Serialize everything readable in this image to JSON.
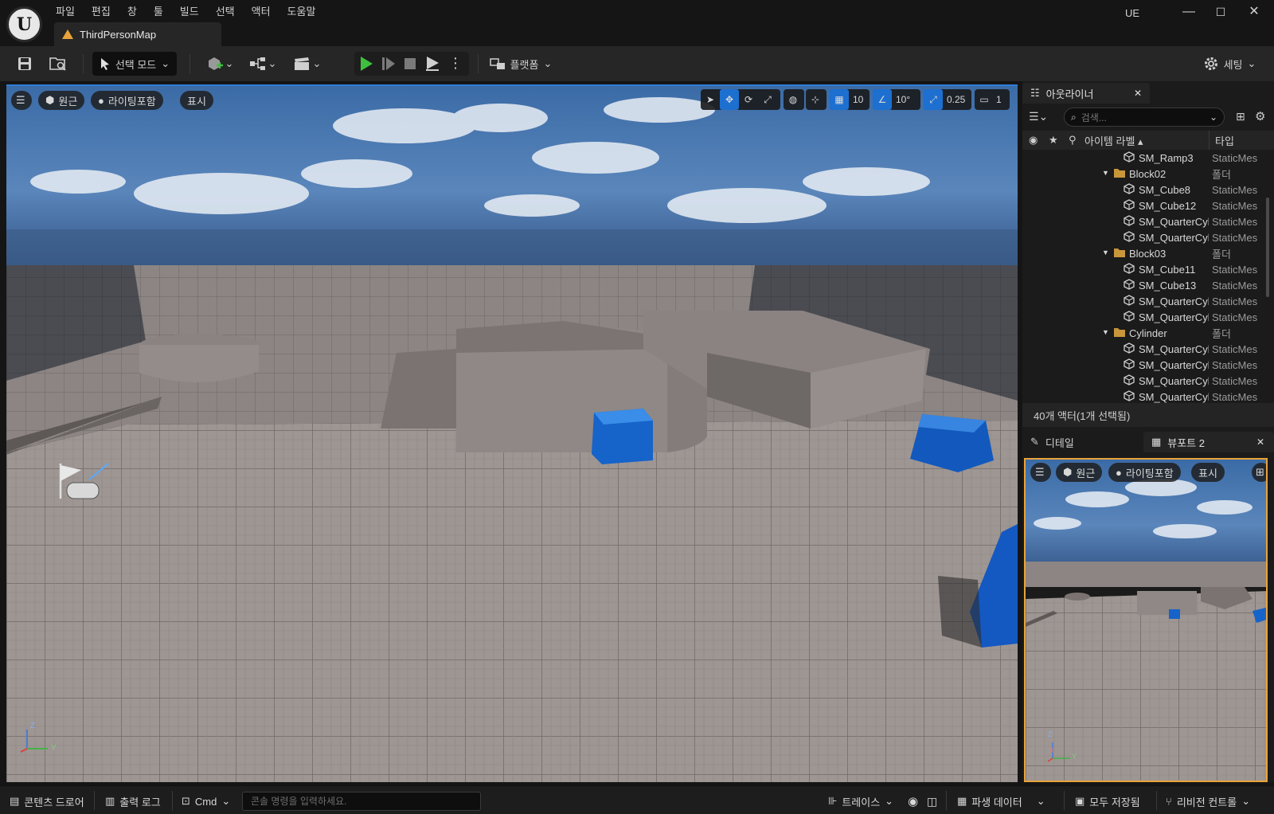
{
  "app": {
    "logo_text": "U",
    "ue_label": "UE",
    "map_tab": "ThirdPersonMap"
  },
  "menu": [
    "파일",
    "편집",
    "창",
    "툴",
    "빌드",
    "선택",
    "액터",
    "도움말"
  ],
  "window_controls": {
    "minimize": "—",
    "maximize": "☐",
    "close": "✕"
  },
  "toolbar": {
    "mode_label": "선택 모드",
    "platform_label": "플랫폼",
    "settings_label": "세팅"
  },
  "viewport": {
    "view_label": "원근",
    "lighting_label": "라이팅포함",
    "show_label": "표시",
    "grid_snap": "10",
    "rotation_snap": "10°",
    "scale_snap": "0.25",
    "camera_speed": "1",
    "axis_z": "Z",
    "axis_y": "Y"
  },
  "outliner": {
    "tab_label": "아웃라이너",
    "search_placeholder": "검색...",
    "col_label": "아이템 라벨 ▴",
    "col_type": "타입",
    "rows": [
      {
        "name": "SM_Ramp3",
        "type": "StaticMes",
        "kind": "mesh"
      },
      {
        "name": "Block02",
        "type": "폴더",
        "kind": "folder"
      },
      {
        "name": "SM_Cube8",
        "type": "StaticMes",
        "kind": "mesh"
      },
      {
        "name": "SM_Cube12",
        "type": "StaticMes",
        "kind": "mesh"
      },
      {
        "name": "SM_QuarterCylir",
        "type": "StaticMes",
        "kind": "mesh"
      },
      {
        "name": "SM_QuarterCylir",
        "type": "StaticMes",
        "kind": "mesh"
      },
      {
        "name": "Block03",
        "type": "폴더",
        "kind": "folder"
      },
      {
        "name": "SM_Cube11",
        "type": "StaticMes",
        "kind": "mesh"
      },
      {
        "name": "SM_Cube13",
        "type": "StaticMes",
        "kind": "mesh"
      },
      {
        "name": "SM_QuarterCylir",
        "type": "StaticMes",
        "kind": "mesh"
      },
      {
        "name": "SM_QuarterCylir",
        "type": "StaticMes",
        "kind": "mesh"
      },
      {
        "name": "Cylinder",
        "type": "폴더",
        "kind": "folder"
      },
      {
        "name": "SM_QuarterCylir",
        "type": "StaticMes",
        "kind": "mesh"
      },
      {
        "name": "SM_QuarterCylir",
        "type": "StaticMes",
        "kind": "mesh"
      },
      {
        "name": "SM_QuarterCylir",
        "type": "StaticMes",
        "kind": "mesh"
      },
      {
        "name": "SM_QuarterCylir",
        "type": "StaticMes",
        "kind": "mesh"
      }
    ],
    "actor_count": "40개 액터(1개 선택됨)"
  },
  "details_tab": "디테일",
  "viewport2_tab": "뷰포트 2",
  "viewport2": {
    "view_label": "원근",
    "lighting_label": "라이팅포함",
    "show_label": "표시",
    "axis_z": "Z",
    "axis_x": "X",
    "axis_y": "Y"
  },
  "statusbar": {
    "content_drawer": "콘텐츠 드로어",
    "output_log": "출력 로그",
    "cmd": "Cmd",
    "console_placeholder": "콘솔 명령을 입력하세요.",
    "trace": "트레이스",
    "derived_data": "파생 데이터",
    "save_all": "모두 저장됨",
    "revision_control": "리비전 컨트롤"
  }
}
